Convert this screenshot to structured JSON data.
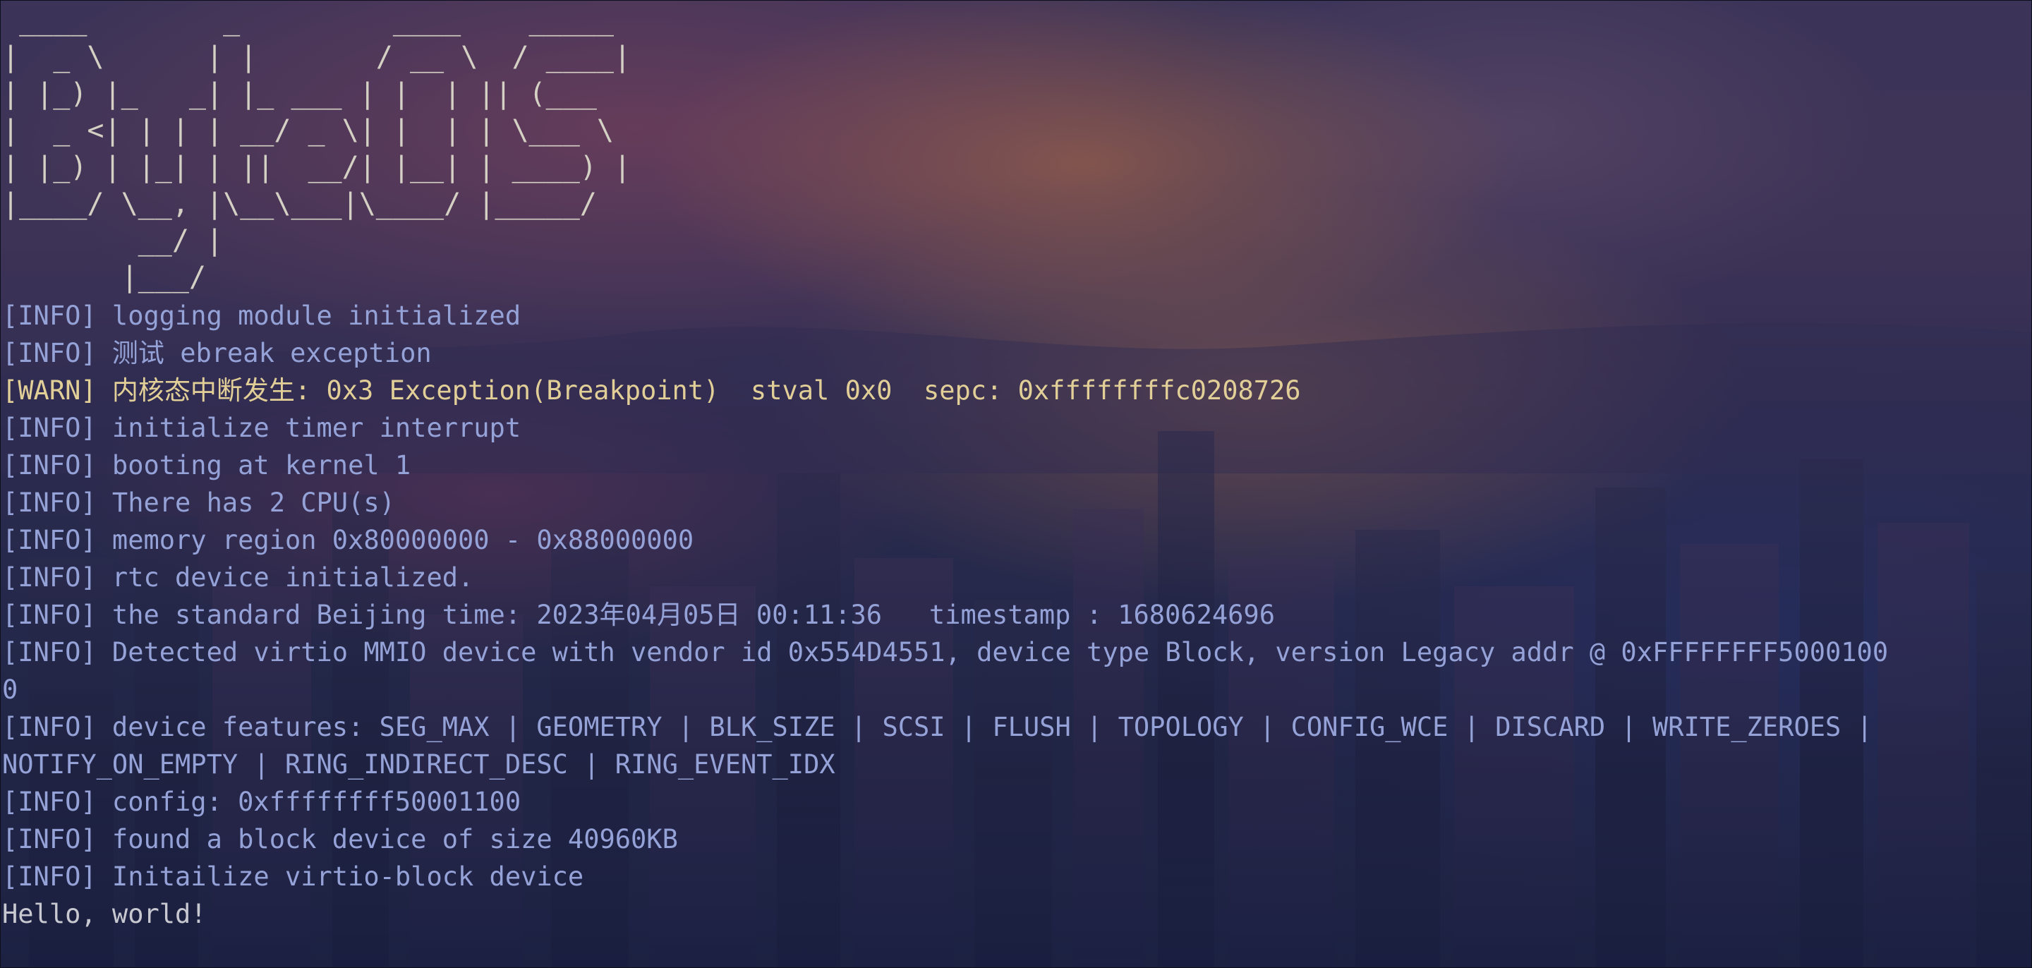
{
  "banner": " ____        _         ____    _____ \n|  _ \\      | |       / __ \\  / ____|\n| |_) |_   _| |_ ___ | |  | || (___  \n|  _ <| | | | __/ _ \\| |  | | \\___ \\ \n| |_) | |_| | ||  __/| |__| | ____) |\n|____/ \\__, |\\__\\___|\\____/ |_____/ \n        __/ |                        \n       |___/                         ",
  "log": [
    {
      "tag": "[INFO]",
      "msg": " logging module initialized"
    },
    {
      "tag": "[INFO]",
      "msg": " 测试 ebreak exception"
    },
    {
      "tag": "[WARN]",
      "msg": " 内核态中断发生: 0x3 Exception(Breakpoint)  stval 0x0  sepc: 0xffffffffc0208726"
    },
    {
      "tag": "[INFO]",
      "msg": " initialize timer interrupt"
    },
    {
      "tag": "[INFO]",
      "msg": " booting at kernel 1"
    },
    {
      "tag": "[INFO]",
      "msg": " There has 2 CPU(s)"
    },
    {
      "tag": "[INFO]",
      "msg": " memory region 0x80000000 - 0x88000000"
    },
    {
      "tag": "[INFO]",
      "msg": " rtc device initialized."
    },
    {
      "tag": "[INFO]",
      "msg": " the standard Beijing time: 2023年04月05日 00:11:36   timestamp : 1680624696"
    },
    {
      "tag": "[INFO]",
      "msg": " Detected virtio MMIO device with vendor id 0x554D4551, device type Block, version Legacy addr @ 0xFFFFFFFF5000100"
    },
    {
      "tag": "",
      "msg": "0"
    },
    {
      "tag": "[INFO]",
      "msg": " device features: SEG_MAX | GEOMETRY | BLK_SIZE | SCSI | FLUSH | TOPOLOGY | CONFIG_WCE | DISCARD | WRITE_ZEROES |"
    },
    {
      "tag": "",
      "msg": "NOTIFY_ON_EMPTY | RING_INDIRECT_DESC | RING_EVENT_IDX"
    },
    {
      "tag": "[INFO]",
      "msg": " config: 0xffffffff50001100"
    },
    {
      "tag": "[INFO]",
      "msg": " found a block device of size 40960KB"
    },
    {
      "tag": "[INFO]",
      "msg": " Initailize virtio-block device"
    },
    {
      "tag": "",
      "msg": "Hello, world!"
    }
  ],
  "colors": {
    "info": "#95a2d8",
    "warn": "#e2cf98",
    "plain": "#c8c8d0",
    "banner": "#d4d1c4"
  }
}
